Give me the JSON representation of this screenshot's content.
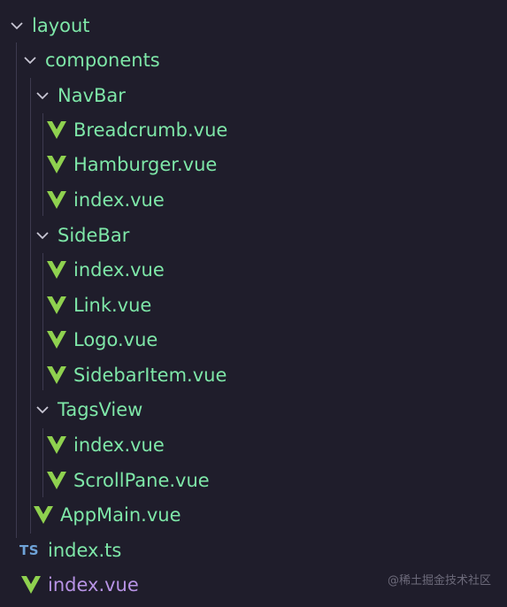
{
  "explorer": {
    "items": [
      {
        "label": "layout",
        "kind": "folder",
        "state": "expanded",
        "depth": 0
      },
      {
        "label": "components",
        "kind": "folder",
        "state": "expanded",
        "depth": 1
      },
      {
        "label": "NavBar",
        "kind": "folder",
        "state": "expanded",
        "depth": 2
      },
      {
        "label": "Breadcrumb.vue",
        "kind": "vue-file",
        "depth": 3
      },
      {
        "label": "Hamburger.vue",
        "kind": "vue-file",
        "depth": 3
      },
      {
        "label": "index.vue",
        "kind": "vue-file",
        "depth": 3
      },
      {
        "label": "SideBar",
        "kind": "folder",
        "state": "expanded",
        "depth": 2
      },
      {
        "label": "index.vue",
        "kind": "vue-file",
        "depth": 3
      },
      {
        "label": "Link.vue",
        "kind": "vue-file",
        "depth": 3
      },
      {
        "label": "Logo.vue",
        "kind": "vue-file",
        "depth": 3
      },
      {
        "label": "SidebarItem.vue",
        "kind": "vue-file",
        "depth": 3
      },
      {
        "label": "TagsView",
        "kind": "folder",
        "state": "expanded",
        "depth": 2
      },
      {
        "label": "index.vue",
        "kind": "vue-file",
        "depth": 3
      },
      {
        "label": "ScrollPane.vue",
        "kind": "vue-file",
        "depth": 3
      },
      {
        "label": "AppMain.vue",
        "kind": "vue-file",
        "depth": 2
      },
      {
        "label": "index.ts",
        "kind": "ts-file",
        "icon_text": "TS",
        "depth": 1
      },
      {
        "label": "index.vue",
        "kind": "vue-file",
        "modified": true,
        "depth": 1
      }
    ]
  },
  "watermark": "@稀土掘金技术社区",
  "colors": {
    "background": "#1f1d2b",
    "label": "#7ee7a8",
    "modified_label": "#b793e5",
    "vue_icon": "#8fd14f",
    "ts_icon": "#6fa3d8",
    "chevron": "#c8c6d4",
    "guide": "#3d3a4f"
  }
}
